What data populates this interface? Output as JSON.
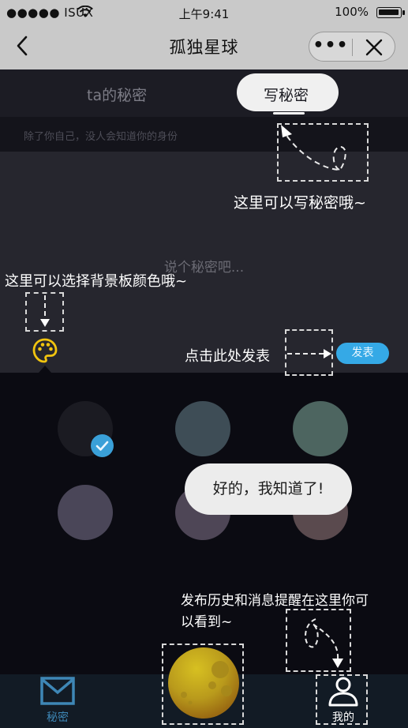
{
  "status_bar": {
    "carrier": "●●●●● ISUX",
    "time": "上午9:41",
    "battery": "100%"
  },
  "nav": {
    "title": "孤独星球",
    "more": "•••"
  },
  "tabs": {
    "ta_secret": "ta的秘密",
    "write_secret": "写秘密"
  },
  "editor": {
    "hint": "除了你自己，没人会知道你的身份",
    "placeholder": "说个秘密吧..."
  },
  "publish_button": "发表",
  "swatches": [
    {
      "color": "#1b1b22",
      "selected": true
    },
    {
      "color": "#3e4d56",
      "selected": false
    },
    {
      "color": "#4d6560",
      "selected": false
    },
    {
      "color": "#4a4658",
      "selected": false
    },
    {
      "color": "#4e4656",
      "selected": false
    },
    {
      "color": "#5a4a4e",
      "selected": false
    }
  ],
  "guides": {
    "write_here": "这里可以写秘密哦~",
    "palette": "这里可以选择背景板颜色哦~",
    "publish": "点击此处发表",
    "history": "发布历史和消息提醒在这里你可以看到~"
  },
  "toast": "好的，我知道了!",
  "bottom_tabs": {
    "secret": "秘密",
    "mine": "我的"
  },
  "colors": {
    "accent": "#35a9e6",
    "palette_icon": "#f1c40f",
    "dark_bg": "#0b0b12"
  }
}
